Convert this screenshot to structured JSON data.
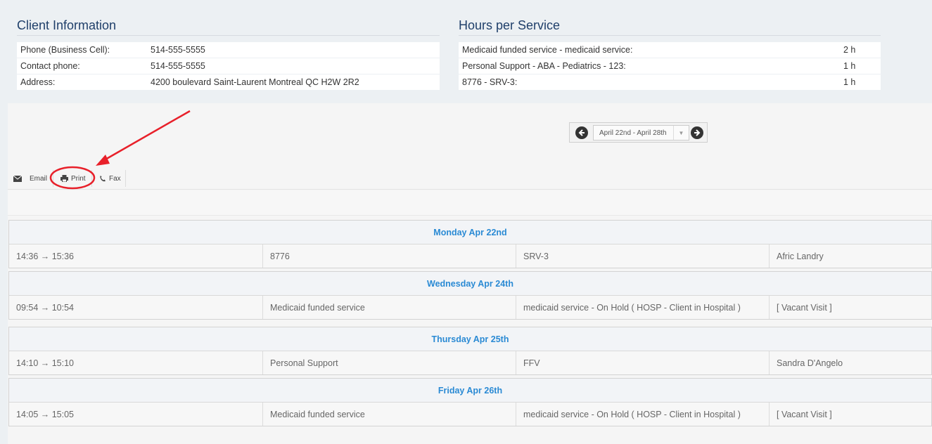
{
  "client_info": {
    "title": "Client Information",
    "rows": [
      {
        "label": "Phone (Business Cell):",
        "value": "514-555-5555"
      },
      {
        "label": "Contact phone:",
        "value": "514-555-5555"
      },
      {
        "label": "Address:",
        "value": "4200 boulevard Saint-Laurent Montreal QC H2W 2R2"
      }
    ]
  },
  "hours_per_service": {
    "title": "Hours per Service",
    "rows": [
      {
        "label": "Medicaid funded service - medicaid service:",
        "value": "2 h"
      },
      {
        "label": "Personal Support - ABA - Pediatrics - 123:",
        "value": "1 h"
      },
      {
        "label": "8776 - SRV-3:",
        "value": "1 h"
      }
    ]
  },
  "week_nav": {
    "range": "April 22nd - April 28th",
    "prev_icon": "arrow-left-circle-icon",
    "next_icon": "arrow-right-circle-icon"
  },
  "toolbar": {
    "email": "Email",
    "print": "Print",
    "fax": "Fax"
  },
  "schedule": [
    {
      "day": "Monday Apr 22nd",
      "time": "14:36 → 15:36",
      "service": "8776",
      "detail": "SRV-3",
      "worker": "Afric Landry"
    },
    {
      "day": "Wednesday Apr 24th",
      "time": "09:54 → 10:54",
      "service": "Medicaid funded service",
      "detail": "medicaid service - On Hold ( HOSP - Client in Hospital )",
      "worker": "[ Vacant Visit ]"
    },
    {
      "day": "Thursday Apr 25th",
      "time": "14:10 → 15:10",
      "service": "Personal Support",
      "detail": "FFV",
      "worker": "Sandra D'Angelo"
    },
    {
      "day": "Friday Apr 26th",
      "time": "14:05 → 15:05",
      "service": "Medicaid funded service",
      "detail": "medicaid service - On Hold ( HOSP - Client in Hospital )",
      "worker": "[ Vacant Visit ]"
    }
  ],
  "colors": {
    "title": "#1f3f6a",
    "day_header": "#2a8ad4",
    "annotation": "#e8202a"
  }
}
